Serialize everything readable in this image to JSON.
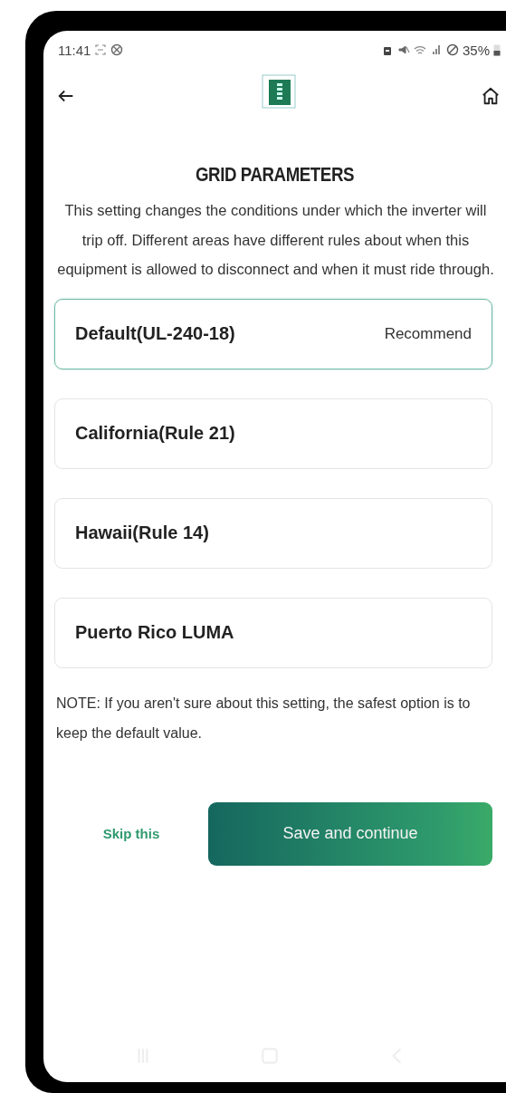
{
  "status_bar": {
    "time": "11:41",
    "battery": "35%"
  },
  "title": "GRID PARAMETERS",
  "description": "This setting changes the conditions under which the inverter will trip off. Different areas have different rules about when this equipment is allowed to disconnect and when it must ride through.",
  "options": [
    {
      "label": "Default(UL-240-18)",
      "badge": "Recommend",
      "selected": true
    },
    {
      "label": "California(Rule 21)",
      "selected": false
    },
    {
      "label": "Hawaii(Rule 14)",
      "selected": false
    },
    {
      "label": "Puerto Rico LUMA",
      "selected": false
    }
  ],
  "note": "NOTE: If you aren't sure about this setting, the safest option is to keep the default value.",
  "buttons": {
    "skip": "Skip this",
    "save": "Save and continue"
  }
}
